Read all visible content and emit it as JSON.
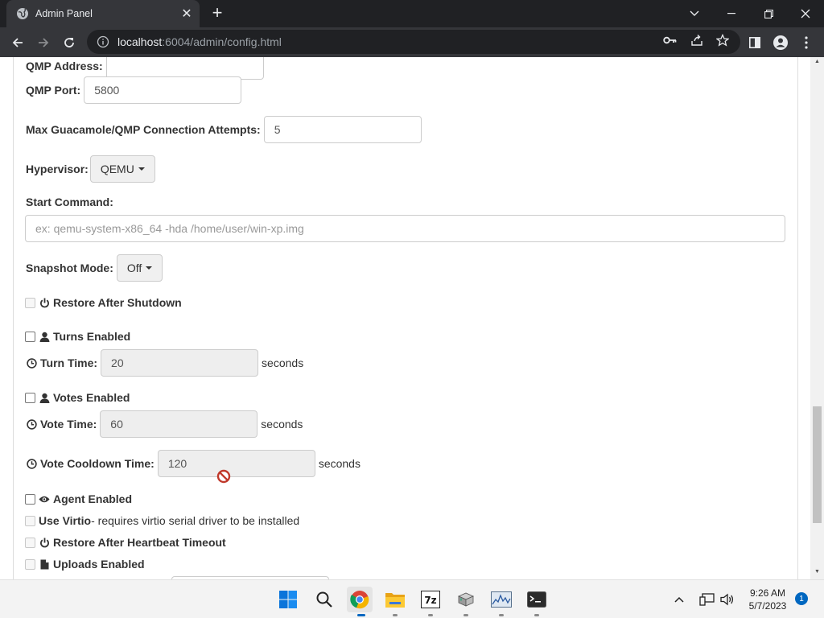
{
  "browser": {
    "tab_title": "Admin Panel",
    "tab_close": "✕",
    "new_tab": "+",
    "url_host": "localhost",
    "url_rest": ":6004/admin/config.html"
  },
  "form": {
    "qmp_address_label": "QMP Address:",
    "qmp_address_value": "",
    "qmp_port_label": "QMP Port:",
    "qmp_port_value": "5800",
    "max_attempts_label": "Max Guacamole/QMP Connection Attempts:",
    "max_attempts_value": "5",
    "hypervisor_label": "Hypervisor:",
    "hypervisor_value": "QEMU",
    "start_command_label": "Start Command:",
    "start_command_placeholder": "ex: qemu-system-x86_64 -hda /home/user/win-xp.img",
    "snapshot_label": "Snapshot Mode:",
    "snapshot_value": "Off",
    "restore_shutdown_label": "Restore After Shutdown",
    "turns_enabled_label": "Turns Enabled",
    "turn_time_label": "Turn Time:",
    "turn_time_value": "20",
    "turn_time_unit": "seconds",
    "votes_enabled_label": "Votes Enabled",
    "vote_time_label": "Vote Time:",
    "vote_time_value": "60",
    "vote_time_unit": "seconds",
    "vote_cooldown_label": "Vote Cooldown Time:",
    "vote_cooldown_value": "120",
    "vote_cooldown_unit": "seconds",
    "agent_enabled_label": "Agent Enabled",
    "use_virtio_label": "Use Virtio",
    "use_virtio_note": " - requires virtio serial driver to be installed",
    "restore_heartbeat_label": "Restore After Heartbeat Timeout",
    "uploads_enabled_label": "Uploads Enabled"
  },
  "taskbar": {
    "time": "9:26 AM",
    "date": "5/7/2023",
    "notifications": "1"
  },
  "colors": {
    "chrome_dark": "#202124",
    "chrome_toolbar": "#35363a",
    "accent": "#0067c0",
    "not_allowed": "#c0392b"
  }
}
